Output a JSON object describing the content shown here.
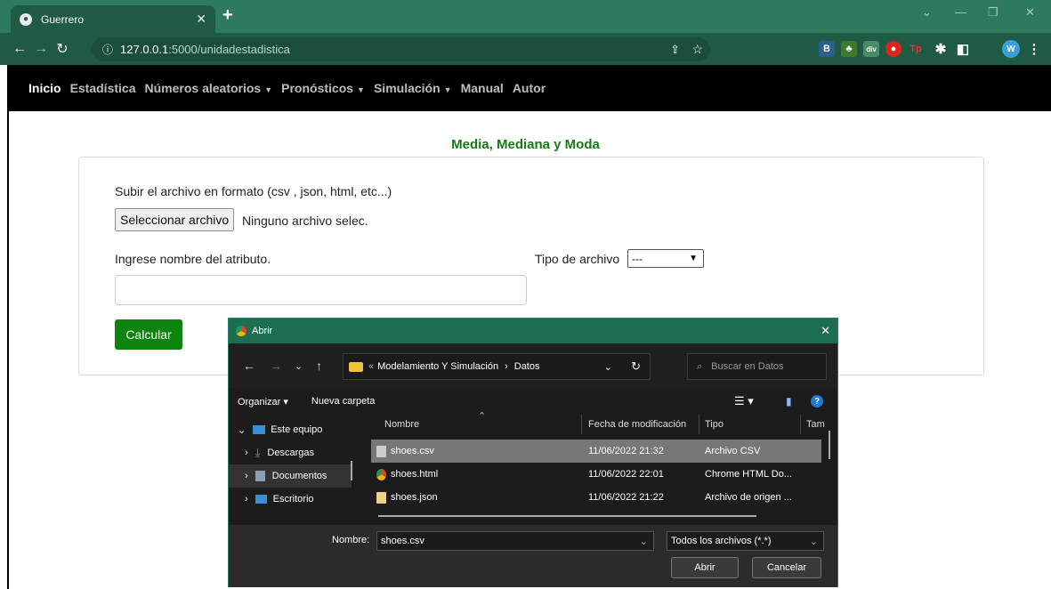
{
  "browser": {
    "tab_title": "Guerrero",
    "url_host": "127.0.0.1",
    "url_path": ":5000/unidadestadistica",
    "profile_initial": "W"
  },
  "navbar": {
    "items": [
      {
        "label": "Inicio"
      },
      {
        "label": "Estadística"
      },
      {
        "label": "Números aleatorios",
        "dropdown": true
      },
      {
        "label": "Pronósticos",
        "dropdown": true
      },
      {
        "label": "Simulación",
        "dropdown": true
      },
      {
        "label": "Manual"
      },
      {
        "label": "Autor"
      }
    ]
  },
  "main": {
    "title": "Media, Mediana y Moda",
    "upload_label": "Subir el archivo en formato (csv , json, html, etc...)",
    "file_button": "Seleccionar archivo",
    "file_status": "Ninguno archivo selec.",
    "attr_label": "Ingrese nombre del atributo.",
    "attr_value": "",
    "type_label": "Tipo de archivo",
    "type_selected": "---",
    "calc_button": "Calcular"
  },
  "dialog": {
    "title": "Abrir",
    "breadcrumb_prefix": "«",
    "breadcrumb_parent": "Modelamiento Y Simulación",
    "breadcrumb_current": "Datos",
    "search_placeholder": "Buscar en Datos",
    "organize": "Organizar",
    "new_folder": "Nueva carpeta",
    "sidebar": [
      {
        "label": "Este equipo",
        "expanded": true
      },
      {
        "label": "Descargas"
      },
      {
        "label": "Documentos",
        "selected": true
      },
      {
        "label": "Escritorio"
      }
    ],
    "columns": {
      "name": "Nombre",
      "date": "Fecha de modificación",
      "type": "Tipo",
      "size": "Tam"
    },
    "files": [
      {
        "name": "shoes.csv",
        "date": "11/06/2022 21:32",
        "type": "Archivo CSV",
        "selected": true
      },
      {
        "name": "shoes.html",
        "date": "11/06/2022 22:01",
        "type": "Chrome HTML Do..."
      },
      {
        "name": "shoes.json",
        "date": "11/06/2022 21:22",
        "type": "Archivo de origen ..."
      }
    ],
    "name_label": "Nombre:",
    "name_value": "shoes.csv",
    "filter": "Todos los archivos (*.*)",
    "open_button": "Abrir",
    "cancel_button": "Cancelar"
  }
}
